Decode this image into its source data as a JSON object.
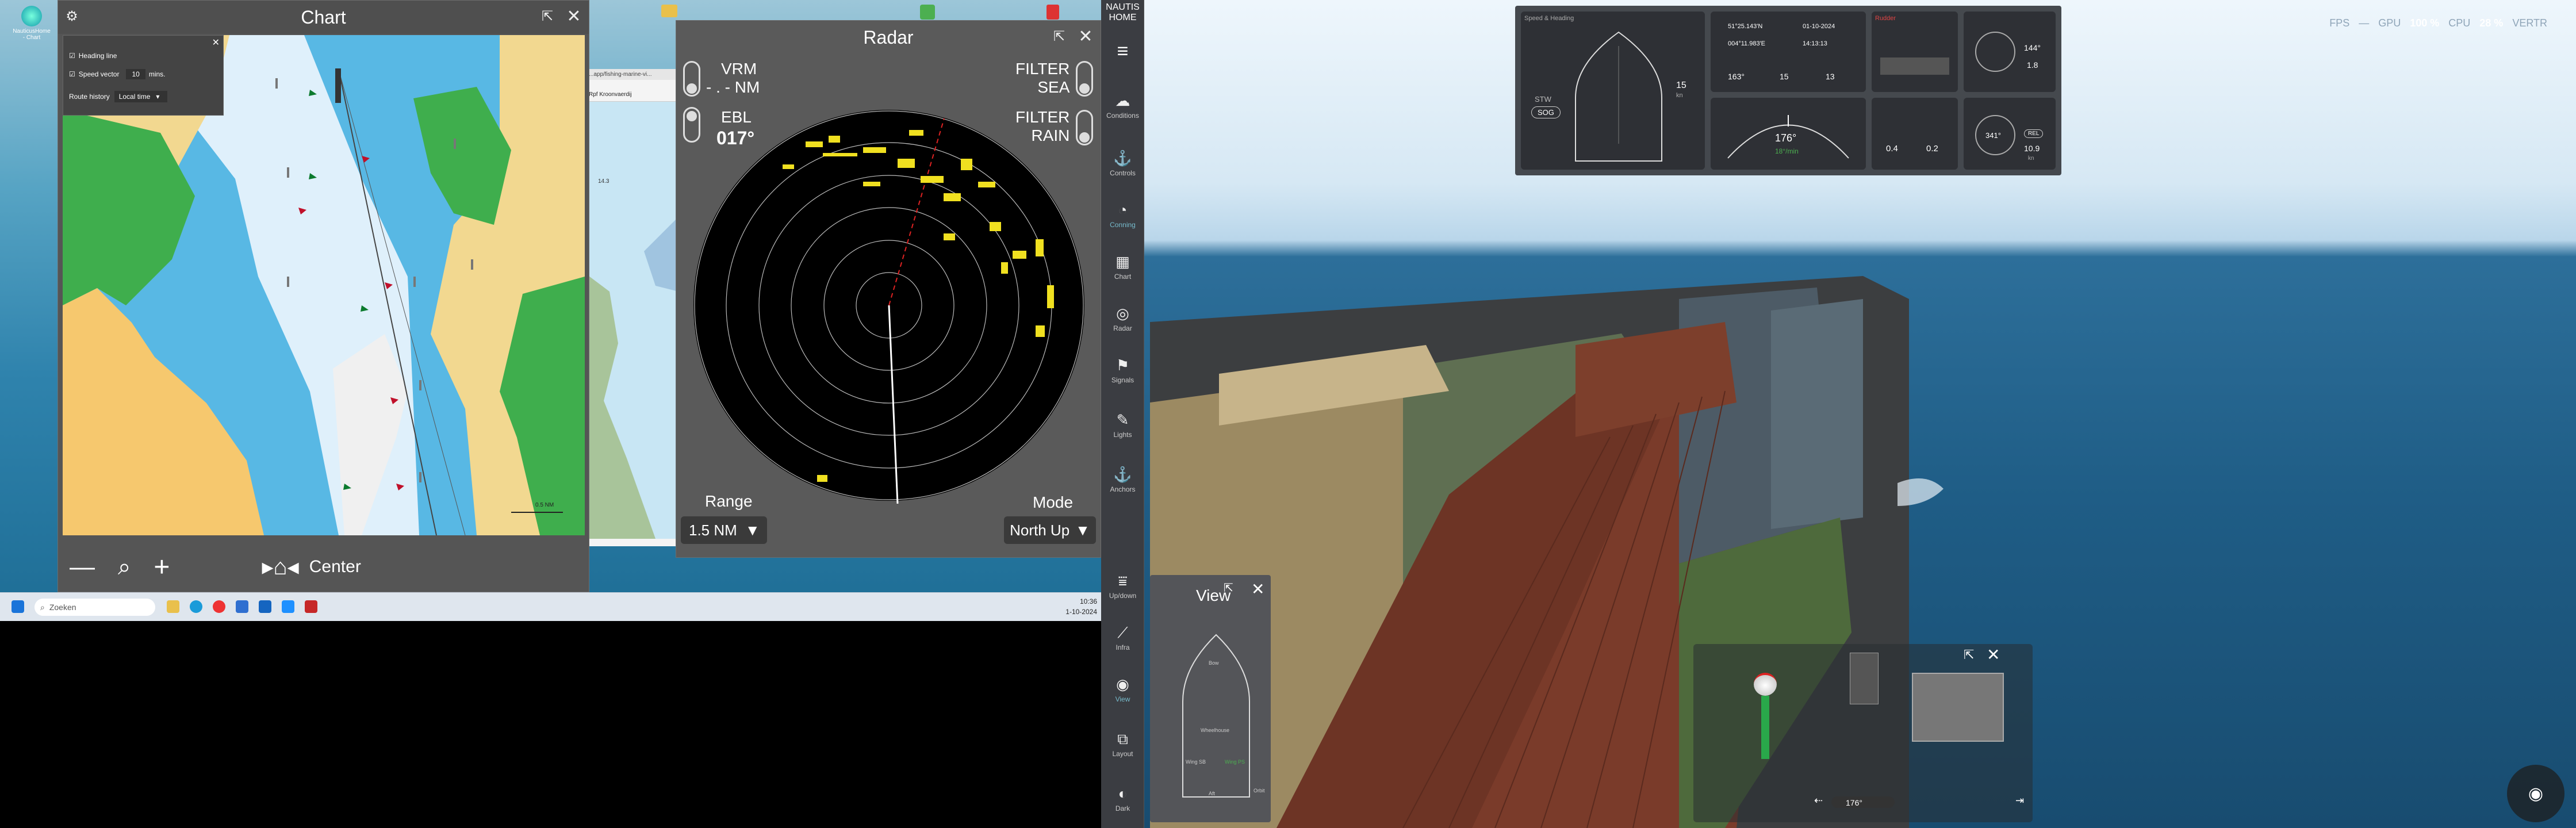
{
  "desktop": {
    "desktop_icon_label": "NauticusHome - Chart",
    "taskbar": {
      "search_placeholder": "Zoeken",
      "clock_time": "10:36",
      "clock_date": "1-10-2024"
    },
    "browser": {
      "url": "...app/fishing-marine-vi...",
      "tab_label": "Rpf Kroonvaerdij",
      "depth_value": "14.3"
    }
  },
  "chart_window": {
    "title": "Chart",
    "settings": {
      "heading_line_label": "Heading line",
      "heading_line_checked": true,
      "speed_vector_label": "Speed vector",
      "speed_vector_checked": true,
      "speed_vector_value": "10",
      "speed_vector_unit": "mins.",
      "route_history_label": "Route history",
      "route_history_value": "Local time"
    },
    "scale_label": "0.5 NM",
    "center_label": "Center"
  },
  "radar_window": {
    "title": "Radar",
    "vrm_label": "VRM",
    "vrm_value": "- . - NM",
    "ebl_label": "EBL",
    "ebl_value": "017°",
    "filter_sea_label": "FILTER\nSEA",
    "filter_rain_label": "FILTER\nRAIN",
    "range_label": "Range",
    "range_value": "1.5 NM",
    "mode_label": "Mode",
    "mode_value": "North Up"
  },
  "sidebar": {
    "home_label": "NAUTIS\nHOME",
    "items": [
      {
        "label": "Conditions",
        "icon": "cloud-icon"
      },
      {
        "label": "Controls",
        "icon": "controls-icon"
      },
      {
        "label": "Conning",
        "icon": "conning-icon"
      },
      {
        "label": "Chart",
        "icon": "grid-icon"
      },
      {
        "label": "Radar",
        "icon": "radar-icon"
      },
      {
        "label": "Signals",
        "icon": "signal-icon"
      },
      {
        "label": "Lights",
        "icon": "lights-icon"
      },
      {
        "label": "Anchors",
        "icon": "anchor-icon"
      },
      {
        "label": "Up/down",
        "icon": "updown-icon"
      },
      {
        "label": "Infra",
        "icon": "infra-icon"
      },
      {
        "label": "View",
        "icon": "eye-icon"
      },
      {
        "label": "Layout",
        "icon": "layout-icon"
      },
      {
        "label": "Dark",
        "icon": "contrast-icon"
      }
    ]
  },
  "status": {
    "fps_label": "FPS",
    "fps_value": "—",
    "gpu_label": "GPU",
    "gpu_value": "100 %",
    "cpu_label": "CPU",
    "cpu_value": "28 %",
    "vertr_label": "VERTR"
  },
  "conning": {
    "speed_title": "Speed & Heading",
    "stw_label": "STW",
    "sog_label": "SOG",
    "speed_value": "15",
    "speed_unit": "kn",
    "pos_lat": "51°25.143'N",
    "pos_lon": "004°11.983'E",
    "date_value": "01-10-2024",
    "time_value": "14:13:13",
    "cog_value": "163°",
    "spd1": "15",
    "spd2": "13",
    "heading_value": "176°",
    "rot_value": "18°/min",
    "rudder_title": "Rudder",
    "compass_value": "144°",
    "wind_speed": "1.8",
    "bow_thruster": "0.4",
    "stern_thruster": "0.2",
    "wind_dir": "341°",
    "wind_rel": "REL",
    "wind_val": "10.9",
    "wind_unit": "kn"
  },
  "view_panel": {
    "title": "View",
    "labels": [
      "Bow",
      "Wheelhouse",
      "Wing SB",
      "Wing PS",
      "Aft",
      "Orbit"
    ]
  },
  "controls_panel": {
    "heading_readout": "176°"
  }
}
